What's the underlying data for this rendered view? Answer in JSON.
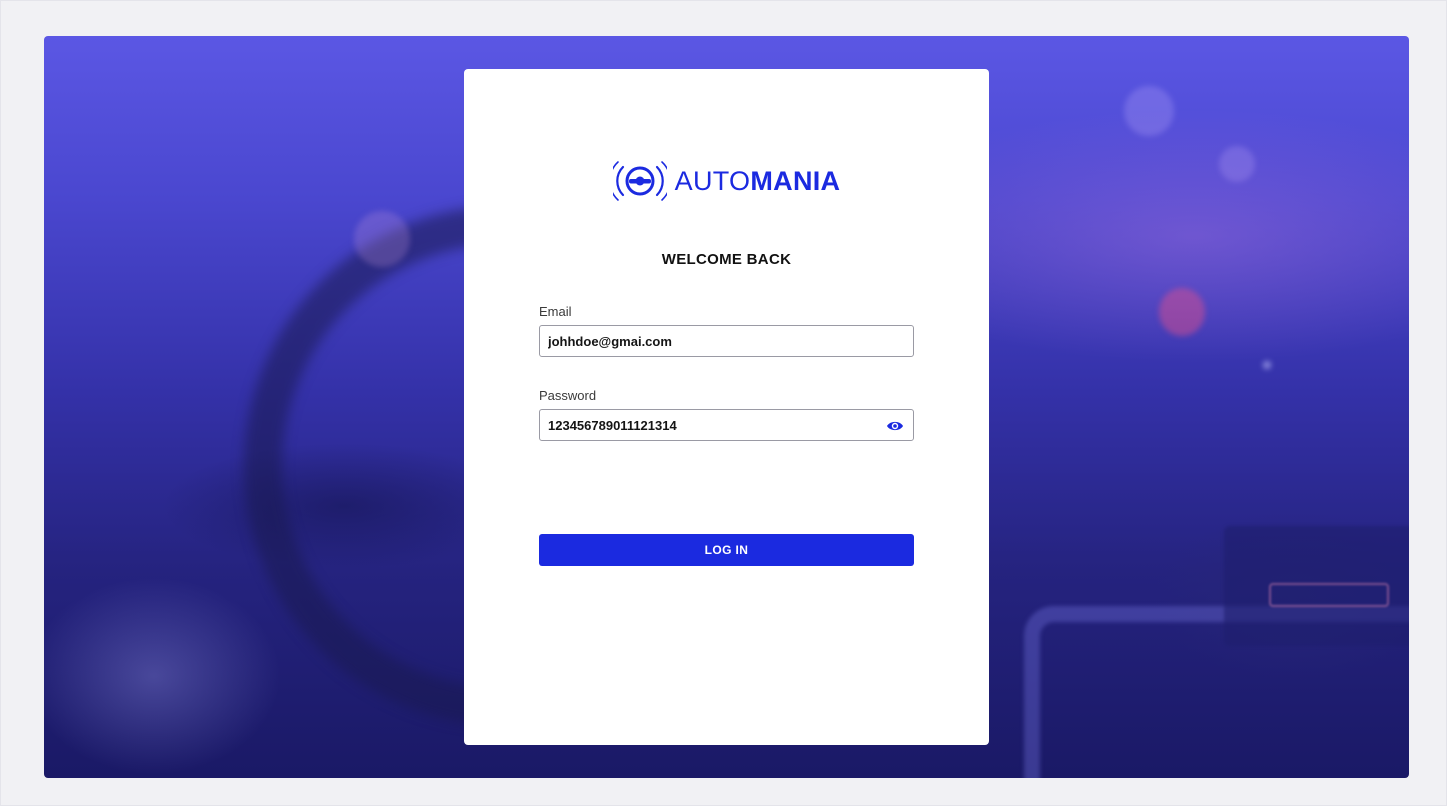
{
  "brand": {
    "name_light": "AUTO",
    "name_bold": "MANIA",
    "icon": "steering-wheel-signal-icon",
    "color": "#1b2ae0"
  },
  "login": {
    "title": "WELCOME BACK",
    "email_label": "Email",
    "email_value": "johhdoe@gmai.com",
    "password_label": "Password",
    "password_value": "123456789011121314",
    "show_password_icon": "eye-icon",
    "submit_label": "LOG IN"
  },
  "colors": {
    "accent": "#1b2ae0",
    "background": "#f1f1f4",
    "hero_tint": "#4a47cf"
  }
}
